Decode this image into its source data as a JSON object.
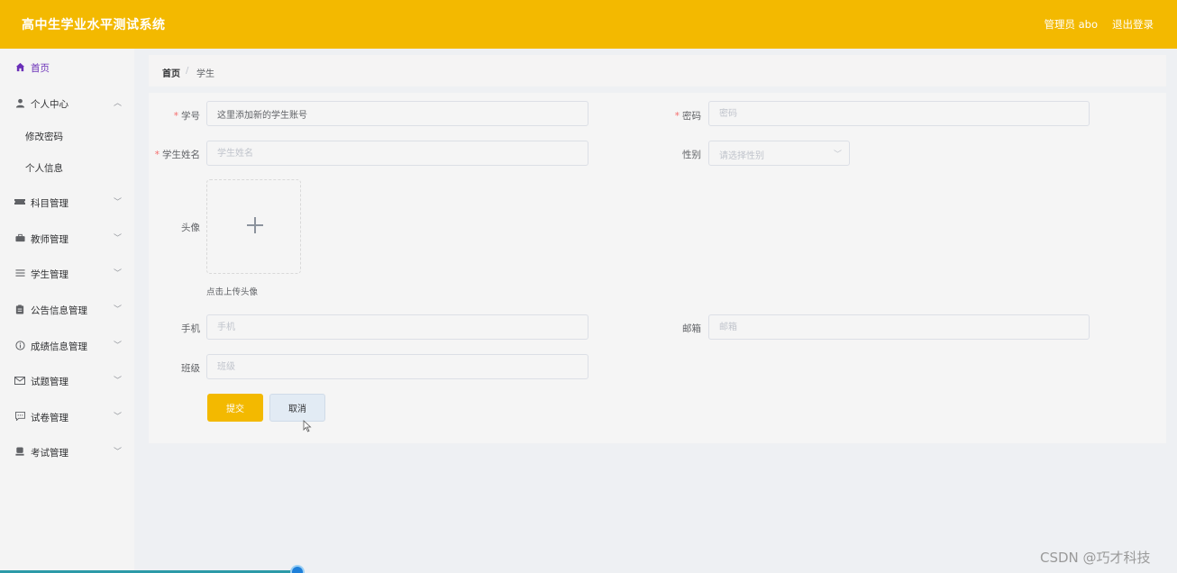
{
  "header": {
    "app_title": "高中生学业水平测试系统",
    "user_label": "管理员 abo",
    "logout_label": "退出登录"
  },
  "sidebar": {
    "items": [
      {
        "label": "首页",
        "icon": "home-icon"
      },
      {
        "label": "个人中心",
        "icon": "user-icon",
        "expanded": true,
        "children": [
          {
            "label": "修改密码"
          },
          {
            "label": "个人信息"
          }
        ]
      },
      {
        "label": "科目管理",
        "icon": "ticket-icon"
      },
      {
        "label": "教师管理",
        "icon": "briefcase-icon"
      },
      {
        "label": "学生管理",
        "icon": "list-icon"
      },
      {
        "label": "公告信息管理",
        "icon": "clipboard-icon"
      },
      {
        "label": "成绩信息管理",
        "icon": "info-icon"
      },
      {
        "label": "试题管理",
        "icon": "mail-icon"
      },
      {
        "label": "试卷管理",
        "icon": "chat-icon"
      },
      {
        "label": "考试管理",
        "icon": "stamp-icon"
      }
    ]
  },
  "breadcrumb": {
    "home": "首页",
    "separator": "/",
    "current": "学生"
  },
  "form": {
    "student_id": {
      "label": "学号",
      "value": "这里添加新的学生账号",
      "required": true
    },
    "password": {
      "label": "密码",
      "placeholder": "密码",
      "required": true
    },
    "student_name": {
      "label": "学生姓名",
      "placeholder": "学生姓名",
      "required": true
    },
    "gender": {
      "label": "性别",
      "placeholder": "请选择性别"
    },
    "avatar": {
      "label": "头像",
      "tip": "点击上传头像"
    },
    "phone": {
      "label": "手机",
      "placeholder": "手机"
    },
    "email": {
      "label": "邮箱",
      "placeholder": "邮箱"
    },
    "class": {
      "label": "班级",
      "placeholder": "班级"
    },
    "submit_label": "提交",
    "cancel_label": "取消"
  },
  "watermark": "CSDN @巧才科技",
  "colors": {
    "brand": "#f3b900",
    "active_menu": "#6a2fb8",
    "required": "#f56c6c"
  }
}
